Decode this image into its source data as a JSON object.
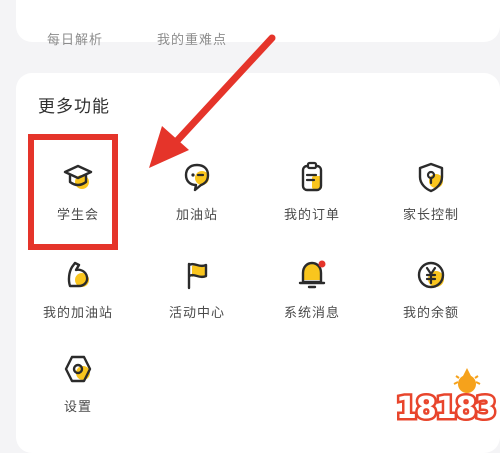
{
  "top_items": [
    {
      "label": "每日解析"
    },
    {
      "label": "我的重难点"
    }
  ],
  "section": {
    "title": "更多功能"
  },
  "features": [
    {
      "label": "学生会",
      "icon": "graduation-cap-icon"
    },
    {
      "label": "加油站",
      "icon": "chat-face-icon"
    },
    {
      "label": "我的订单",
      "icon": "clipboard-icon"
    },
    {
      "label": "家长控制",
      "icon": "shield-icon"
    },
    {
      "label": "我的加油站",
      "icon": "flex-arm-icon"
    },
    {
      "label": "活动中心",
      "icon": "flag-icon"
    },
    {
      "label": "系统消息",
      "icon": "bell-icon"
    },
    {
      "label": "我的余额",
      "icon": "yen-coin-icon"
    },
    {
      "label": "设置",
      "icon": "settings-hex-icon"
    }
  ],
  "watermark": {
    "text": "18183"
  },
  "colors": {
    "accent": "#f9c51e",
    "highlight": "#e5342a",
    "icon_stroke": "#2b2b2b"
  }
}
